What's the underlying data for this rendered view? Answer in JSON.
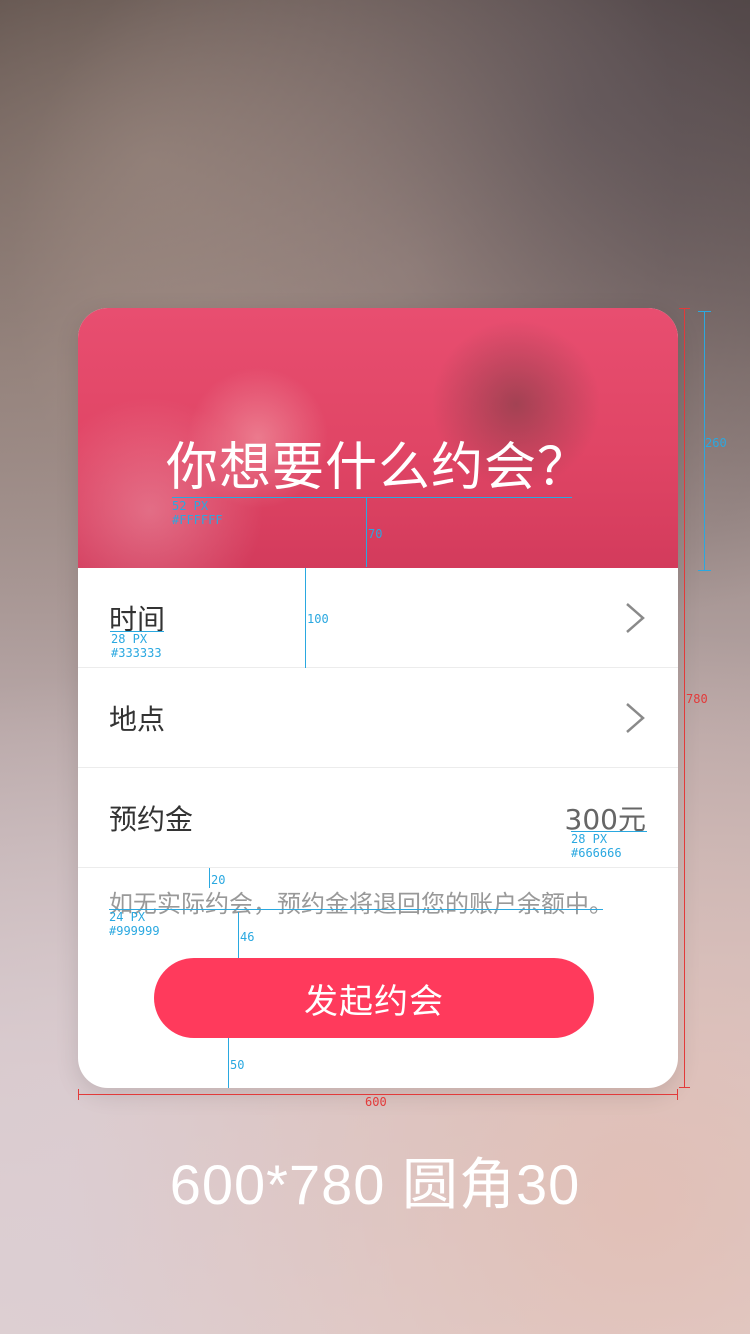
{
  "hero": {
    "title": "你想要什么约会？"
  },
  "rows": [
    {
      "label": "时间",
      "value": ""
    },
    {
      "label": "地点",
      "value": ""
    },
    {
      "label": "预约金",
      "value": "300元"
    }
  ],
  "note": "如无实际约会，预约金将退回您的账户余额中。",
  "cta": {
    "label": "发起约会"
  },
  "annotations": {
    "title_size": "52 PX",
    "title_color": "#FFFFFF",
    "title_gap": "70",
    "row_height": "100",
    "label_size": "28 PX",
    "label_color": "#333333",
    "value_size": "28 PX",
    "value_color": "#666666",
    "note_gap_top": "20",
    "note_size": "24 PX",
    "note_color": "#999999",
    "button_gap_top": "46",
    "button_gap_bottom": "50",
    "hero_height": "260",
    "card_height": "780",
    "card_width": "600"
  },
  "caption": "600*780  圆角30",
  "colors": {
    "accent": "#ff3a5c",
    "hero": "#e04565",
    "annotation": "#2aa8e0",
    "dimension": "#e23a3a"
  }
}
